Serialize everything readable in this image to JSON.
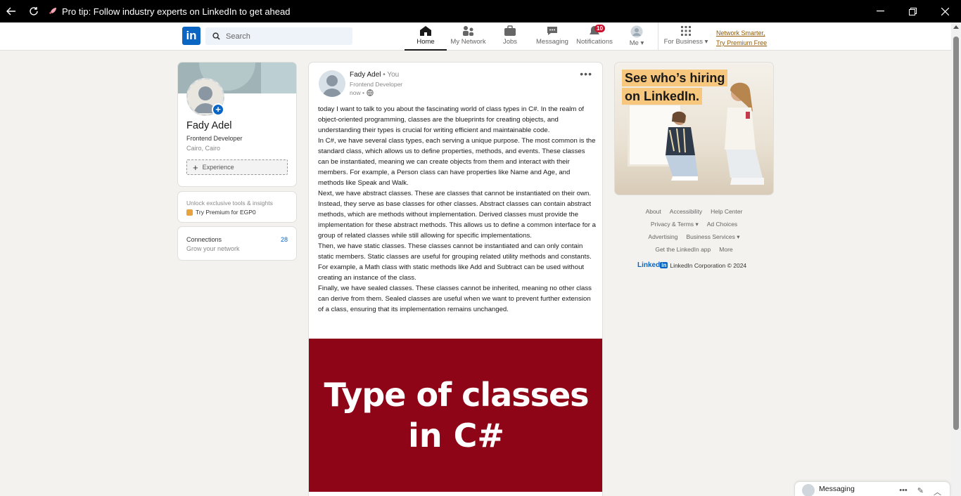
{
  "titlebar": {
    "title": "Pro tip: Follow industry experts on LinkedIn to get ahead"
  },
  "nav": {
    "logo": "in",
    "search_placeholder": "Search",
    "items": [
      {
        "label": "Home",
        "icon": "home-icon",
        "active": true
      },
      {
        "label": "My Network",
        "icon": "network-icon"
      },
      {
        "label": "Jobs",
        "icon": "briefcase-icon"
      },
      {
        "label": "Messaging",
        "icon": "chat-icon"
      },
      {
        "label": "Notifications",
        "icon": "bell-icon",
        "badge": "10"
      },
      {
        "label": "Me",
        "icon": "avatar-icon"
      },
      {
        "label": "For Business",
        "icon": "grid-icon"
      }
    ],
    "premium_line1": "Network Smarter,",
    "premium_line2": "Try Premium Free"
  },
  "profile": {
    "name": "Fady Adel",
    "title": "Frontend Developer",
    "location": "Cairo, Cairo",
    "experience_label": "Experience",
    "premium_teaser": "Unlock exclusive tools & insights",
    "premium_link": "Try Premium for EGP0",
    "connections_label": "Connections",
    "connections_sub": "Grow your network",
    "connections_count": "28"
  },
  "post": {
    "author": "Fady Adel",
    "author_suffix": " • You",
    "role": "Frontend Developer",
    "time": "now •",
    "paragraphs": [
      "today I want to talk to you about the fascinating world of class types in C#. In the realm of object-oriented programming, classes are the blueprints for creating objects, and understanding their types is crucial for writing efficient and maintainable code.",
      "In C#, we have several class types, each serving a unique purpose. The most common is the standard class, which allows us to define properties, methods, and events. These classes can be instantiated, meaning we can create objects from them and interact with their members. For example, a Person class can have properties like Name and Age, and methods like Speak and Walk.",
      "Next, we have abstract classes. These are classes that cannot be instantiated on their own. Instead, they serve as base classes for other classes. Abstract classes can contain abstract methods, which are methods without implementation. Derived classes must provide the implementation for these abstract methods. This allows us to define a common interface for a group of related classes while still allowing for specific implementations.",
      "Then, we have static classes. These classes cannot be instantiated and can only contain static members. Static classes are useful for grouping related utility methods and constants. For example, a Math class with static methods like Add and Subtract can be used without creating an instance of the class.",
      "Finally, we have sealed classes. These classes cannot be inherited, meaning no other class can derive from them. Sealed classes are useful when we want to prevent further extension of a class, ensuring that its implementation remains unchanged."
    ],
    "image_line1": "Type of classes",
    "image_line2": "in C#",
    "image_bg": "#8e0517"
  },
  "ad": {
    "line1": "See who’s hiring",
    "line2": "on LinkedIn."
  },
  "footer": {
    "row1": [
      "About",
      "Accessibility",
      "Help Center"
    ],
    "row2": [
      "Privacy & Terms",
      "Ad Choices"
    ],
    "row3": [
      "Advertising",
      "Business Services"
    ],
    "row4": [
      "Get the LinkedIn app",
      "More"
    ],
    "brand_word": "Linked",
    "brand_box": "in",
    "copyright": "LinkedIn Corporation © 2024"
  },
  "messaging": {
    "label": "Messaging"
  },
  "colors": {
    "accent": "#0a66c2",
    "premium": "#915907",
    "badge": "#cb112d"
  }
}
